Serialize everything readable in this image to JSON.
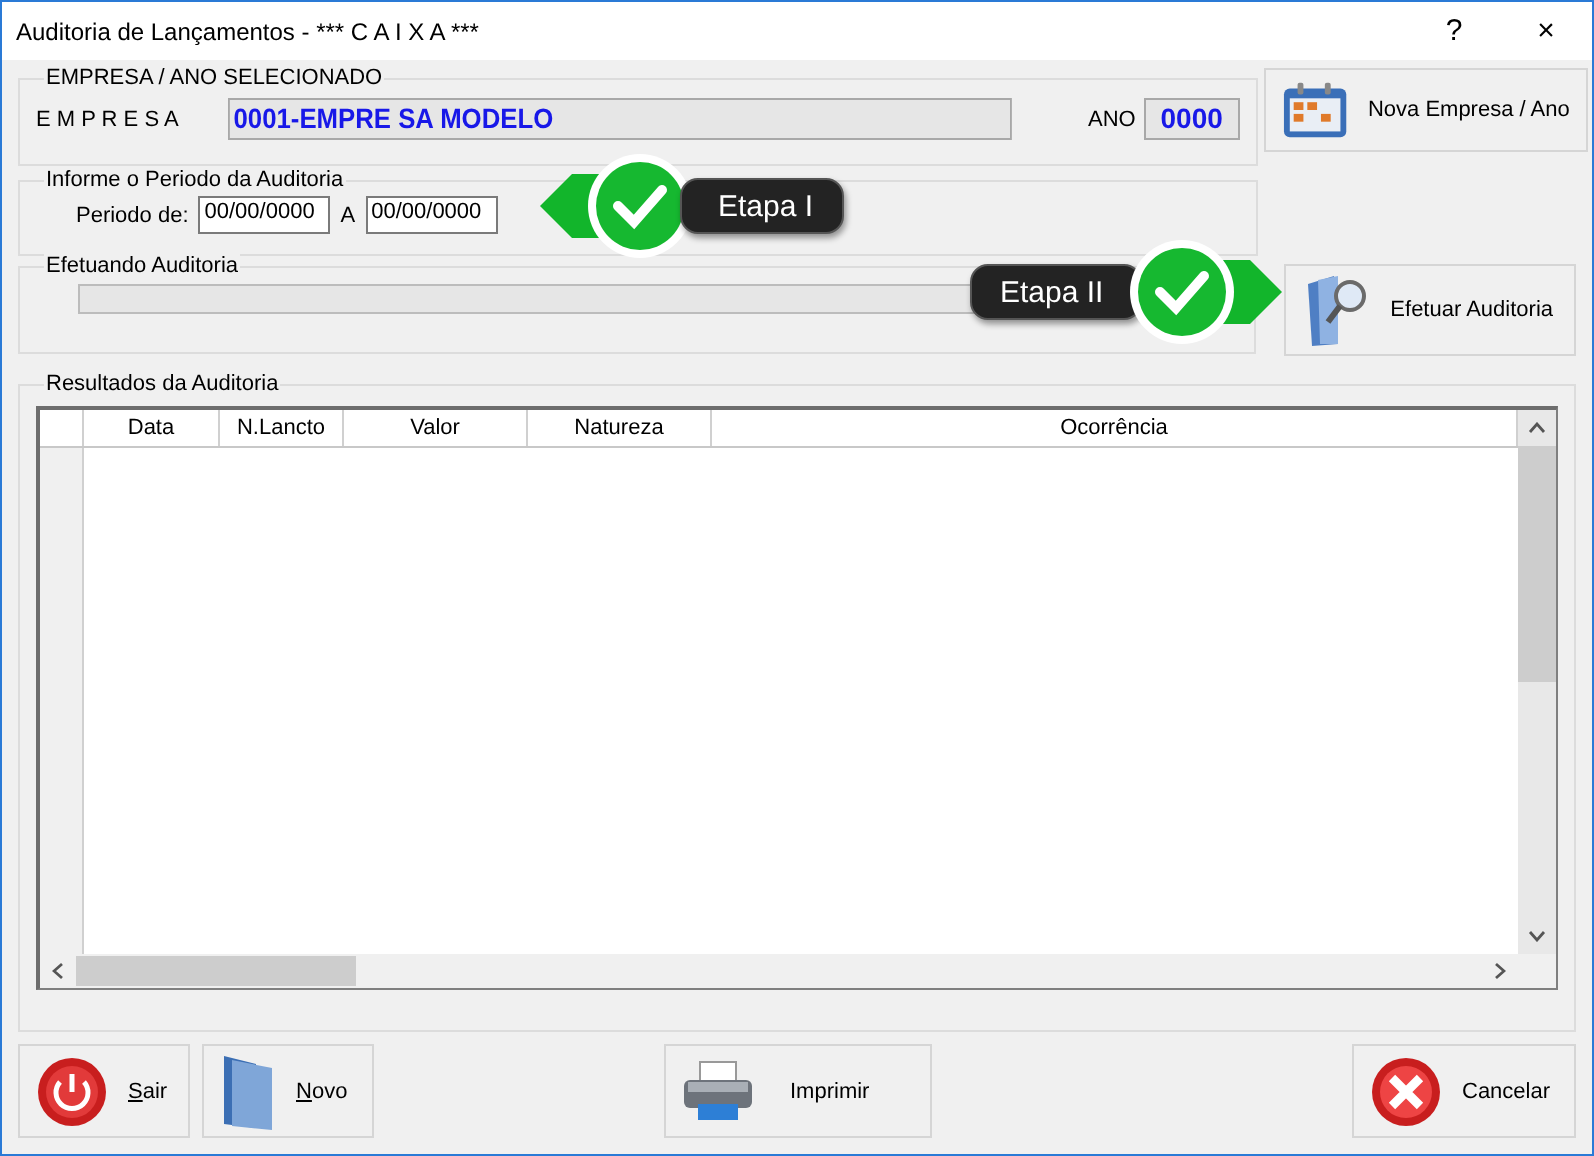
{
  "window": {
    "title": "Auditoria de Lançamentos - *** C A I X A ***",
    "controls": [
      "?",
      "×"
    ]
  },
  "company_group": {
    "legend": "EMPRESA / ANO SELECIONADO",
    "company_label": "E M P R E S A",
    "company_value": "0001-EMPRE SA MODELO",
    "year_label": "ANO",
    "year_value": "0000"
  },
  "new_company_button": {
    "label": "Nova Empresa / Ano"
  },
  "period_group": {
    "legend": "Informe o Periodo da Auditoria",
    "from_label": "Periodo de:",
    "from_value": "00/00/0000",
    "to_label": "A",
    "to_value": "00/00/0000"
  },
  "progress_group": {
    "legend": "Efetuando Auditoria",
    "level": 0
  },
  "run_button": {
    "label": "Efetuar Auditoria"
  },
  "callouts": [
    {
      "label": "Etapa I",
      "kind": "left"
    },
    {
      "label": "Etapa II",
      "kind": "right"
    }
  ],
  "results": {
    "legend": "Resultados da Auditoria",
    "columns": [
      "Data",
      "N.Lancto",
      "Valor",
      "Natureza",
      "Ocorrência"
    ]
  },
  "buttons": [
    {
      "label": "Sair",
      "kind": "power"
    },
    {
      "label": "Novo",
      "kind": "folder"
    },
    {
      "label": "Imprimir",
      "kind": "printer"
    },
    {
      "label": "Cancelar",
      "kind": "cancel"
    }
  ]
}
